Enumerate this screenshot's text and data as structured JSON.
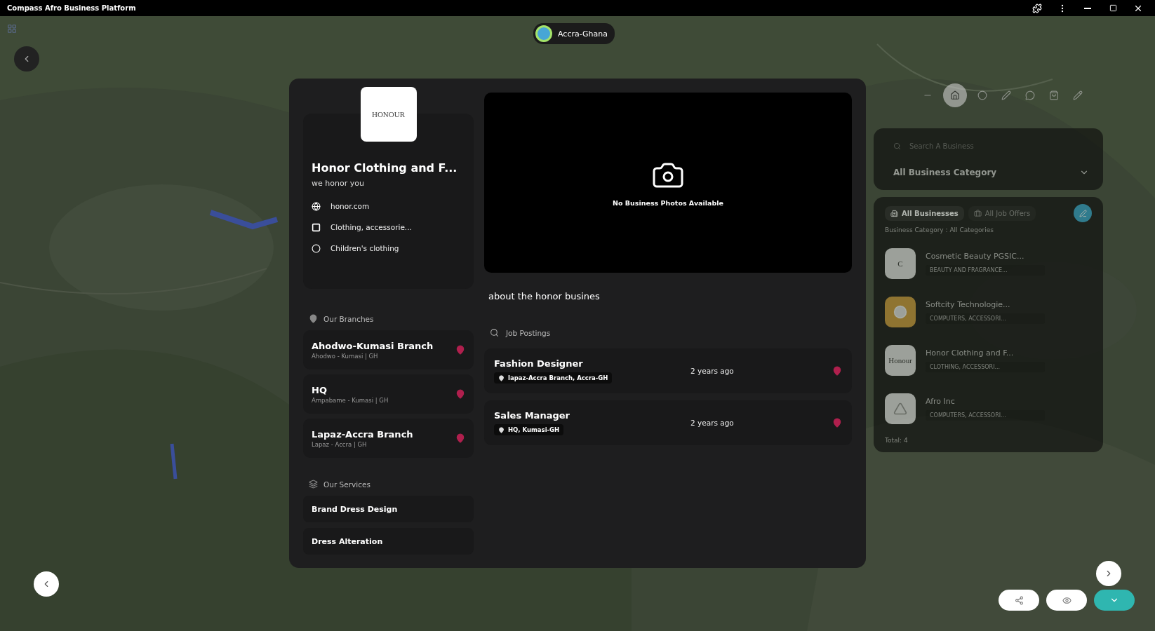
{
  "window": {
    "title": "Compass Afro Business Platform",
    "controls": [
      {
        "kind": "extensions"
      },
      {
        "kind": "menu"
      },
      {
        "kind": "minimize"
      },
      {
        "kind": "maximize"
      },
      {
        "kind": "close"
      }
    ]
  },
  "location": {
    "label": "Accra-Ghana"
  },
  "business": {
    "logo_text": "HONOUR",
    "name": "Honor Clothing and F...",
    "tagline": "we honor you",
    "details": [
      {
        "kind": "website",
        "text": "honor.com"
      },
      {
        "kind": "category",
        "text": "Clothing, accessorie..."
      },
      {
        "kind": "subcategory",
        "text": "Children's clothing"
      }
    ],
    "photos_message": "No Business Photos Available",
    "about": "about the honor busines"
  },
  "branches": {
    "title": "Our Branches",
    "items": [
      {
        "name": "Ahodwo-Kumasi Branch",
        "address": "Ahodwo - Kumasi | GH"
      },
      {
        "name": "HQ",
        "address": "Ampabame - Kumasi | GH"
      },
      {
        "name": "Lapaz-Accra Branch",
        "address": "Lapaz - Accra | GH"
      }
    ]
  },
  "services": {
    "title": "Our Services",
    "items": [
      "Brand Dress Design",
      "Dress Alteration"
    ]
  },
  "jobs": {
    "title": "Job Postings",
    "items": [
      {
        "title": "Fashion Designer",
        "location": "lapaz-Accra Branch, Accra-GH",
        "posted": "2 years ago"
      },
      {
        "title": "Sales Manager",
        "location": "HQ, Kumasi-GH",
        "posted": "2 years ago"
      }
    ]
  },
  "map_tools": [
    {
      "kind": "minus",
      "selected": false
    },
    {
      "kind": "home",
      "selected": true
    },
    {
      "kind": "circle",
      "selected": false
    },
    {
      "kind": "pen",
      "selected": false
    },
    {
      "kind": "chat",
      "selected": false
    },
    {
      "kind": "bag",
      "selected": false
    },
    {
      "kind": "pencil",
      "selected": false
    }
  ],
  "sidebar": {
    "search": {
      "placeholder": "Search A Business"
    },
    "category_select": "All Business Category",
    "tabs": [
      {
        "label": "All Businesses",
        "selected": true
      },
      {
        "label": "All Job Offers",
        "selected": false
      }
    ],
    "filter_label": "Business Category : All Categories",
    "businesses": [
      {
        "name": "Cosmetic Beauty PGSIC...",
        "category": "BEAUTY AND FRAGRANCE...",
        "kind": "letter",
        "logo_text": "C"
      },
      {
        "name": "Softcity Technologie...",
        "category": "COMPUTERS, ACCESSORI...",
        "kind": "gold"
      },
      {
        "name": "Honor Clothing and F...",
        "category": "CLOTHING, ACCESSORI...",
        "kind": "letter",
        "logo_text": "Honour"
      },
      {
        "name": "Afro Inc",
        "category": "COMPUTERS, ACCESSORI...",
        "kind": "outline"
      }
    ],
    "total": "Total: 4"
  }
}
